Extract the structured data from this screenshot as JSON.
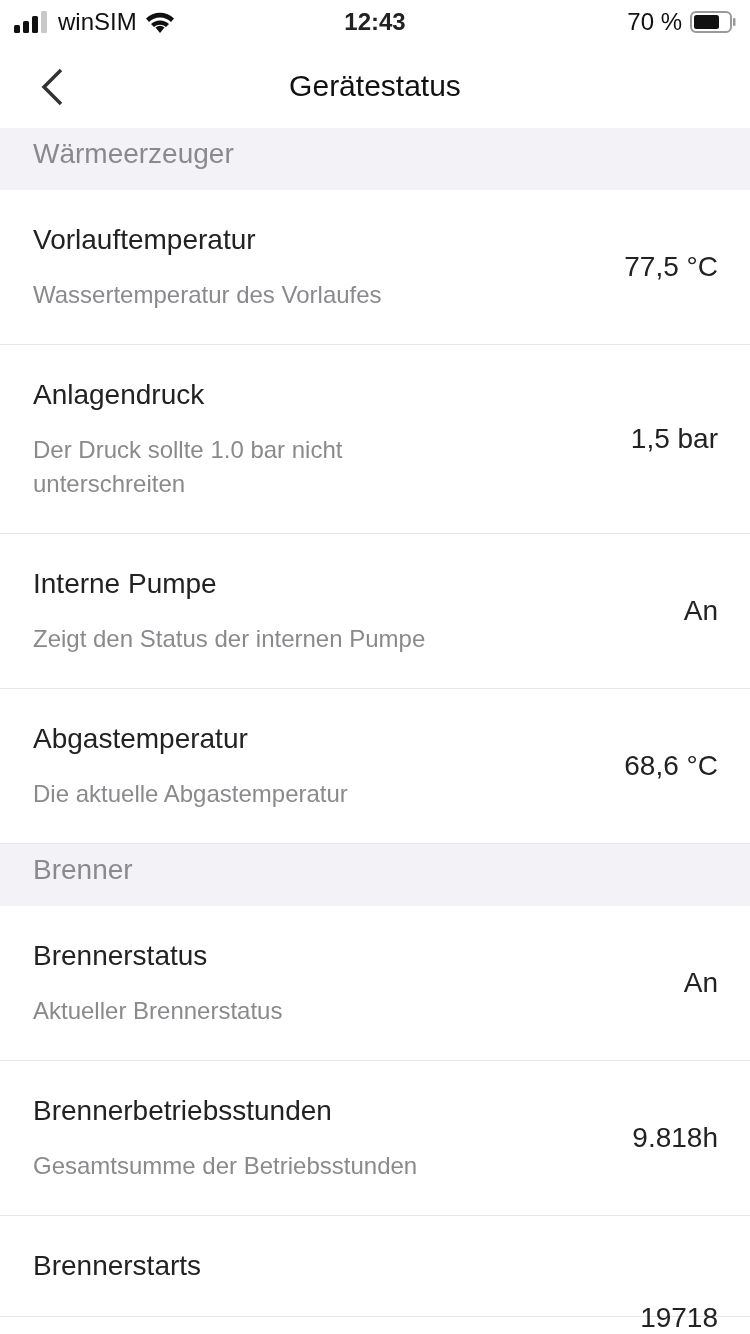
{
  "status_bar": {
    "carrier": "winSIM",
    "time": "12:43",
    "battery": "70 %"
  },
  "nav": {
    "title": "Gerätestatus"
  },
  "sections": [
    {
      "title": "Wärmeerzeuger",
      "rows": [
        {
          "title": "Vorlauftemperatur",
          "subtitle": "Wassertemperatur des Vorlaufes",
          "value": "77,5 °C"
        },
        {
          "title": "Anlagendruck",
          "subtitle": "Der Druck sollte 1.0 bar nicht unterschreiten",
          "value": "1,5 bar"
        },
        {
          "title": "Interne Pumpe",
          "subtitle": "Zeigt den Status der internen Pumpe",
          "value": "An"
        },
        {
          "title": "Abgastemperatur",
          "subtitle": "Die aktuelle Abgastemperatur",
          "value": "68,6 °C"
        }
      ]
    },
    {
      "title": "Brenner",
      "rows": [
        {
          "title": "Brennerstatus",
          "subtitle": "Aktueller Brennerstatus",
          "value": "An"
        },
        {
          "title": "Brennerbetriebsstunden",
          "subtitle": "Gesamtsumme der Betriebsstunden",
          "value": "9.818h"
        },
        {
          "title": "Brennerstarts",
          "value": "19718"
        }
      ]
    }
  ]
}
